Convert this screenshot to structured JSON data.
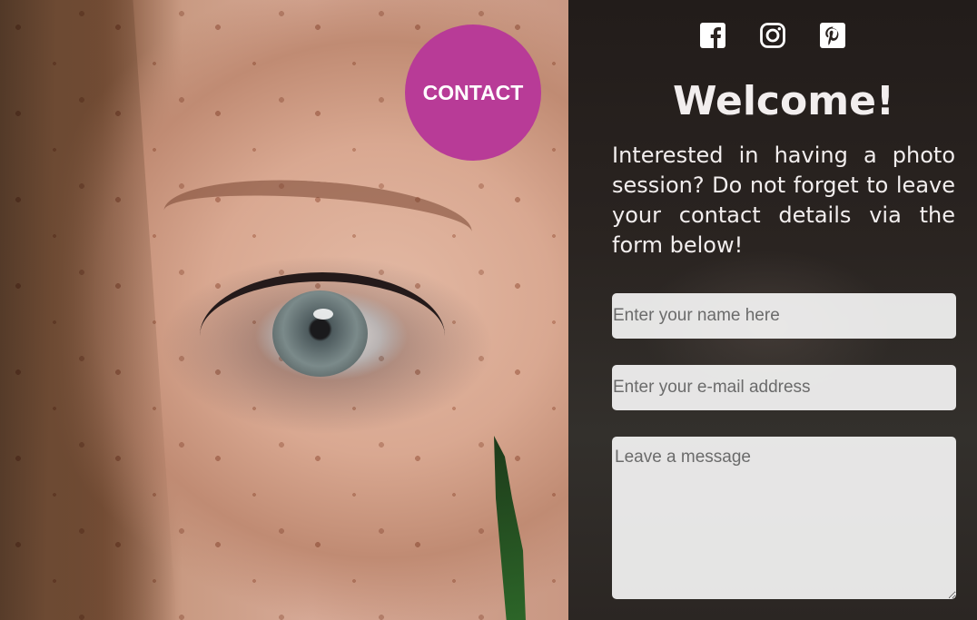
{
  "contact_button": {
    "label": "CONTACT",
    "color": "#b83b97"
  },
  "social": [
    {
      "name": "facebook-icon"
    },
    {
      "name": "instagram-icon"
    },
    {
      "name": "pinterest-icon"
    }
  ],
  "welcome": {
    "title": "Welcome!",
    "intro": "Interested in having a photo session? Do not forget to leave your contact details via the form below!"
  },
  "form": {
    "name_placeholder": "Enter your name here",
    "email_placeholder": "Enter your e-mail address",
    "message_placeholder": "Leave a message"
  }
}
